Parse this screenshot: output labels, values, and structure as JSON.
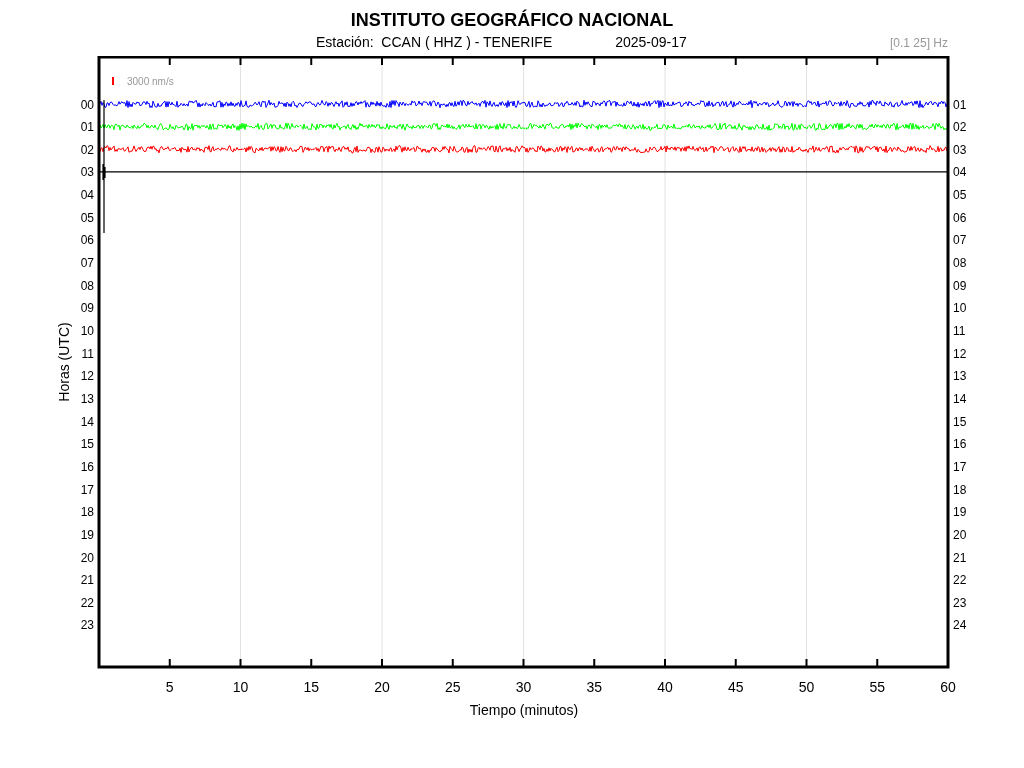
{
  "title": "INSTITUTO GEOGRÁFICO NACIONAL",
  "subtitle": {
    "station": "Estación:  CCAN ( HHZ ) - TENERIFE",
    "date": "2025-09-17",
    "filter": "[0.1 25] Hz"
  },
  "plot": {
    "scale_label": "3000 nm/s",
    "left_hours": [
      "00",
      "01",
      "02",
      "03",
      "04",
      "05",
      "06",
      "07",
      "08",
      "09",
      "10",
      "11",
      "12",
      "13",
      "14",
      "15",
      "16",
      "17",
      "18",
      "19",
      "20",
      "21",
      "22",
      "23"
    ],
    "right_hours": [
      "01",
      "02",
      "03",
      "04",
      "05",
      "06",
      "07",
      "08",
      "09",
      "10",
      "11",
      "12",
      "13",
      "14",
      "15",
      "16",
      "17",
      "18",
      "19",
      "20",
      "21",
      "22",
      "23",
      "24"
    ],
    "x_ticks": [
      "5",
      "10",
      "15",
      "20",
      "25",
      "30",
      "35",
      "40",
      "45",
      "50",
      "55",
      "60"
    ],
    "xlabel": "Tiempo (minutos)",
    "ylabel": "Horas (UTC)",
    "traces": [
      {
        "kind": "noise",
        "color": "#0000ff"
      },
      {
        "kind": "noise",
        "color": "#00ff00"
      },
      {
        "kind": "noise",
        "color": "#ff0000"
      },
      {
        "kind": "flat",
        "color": "#000000"
      }
    ]
  }
}
